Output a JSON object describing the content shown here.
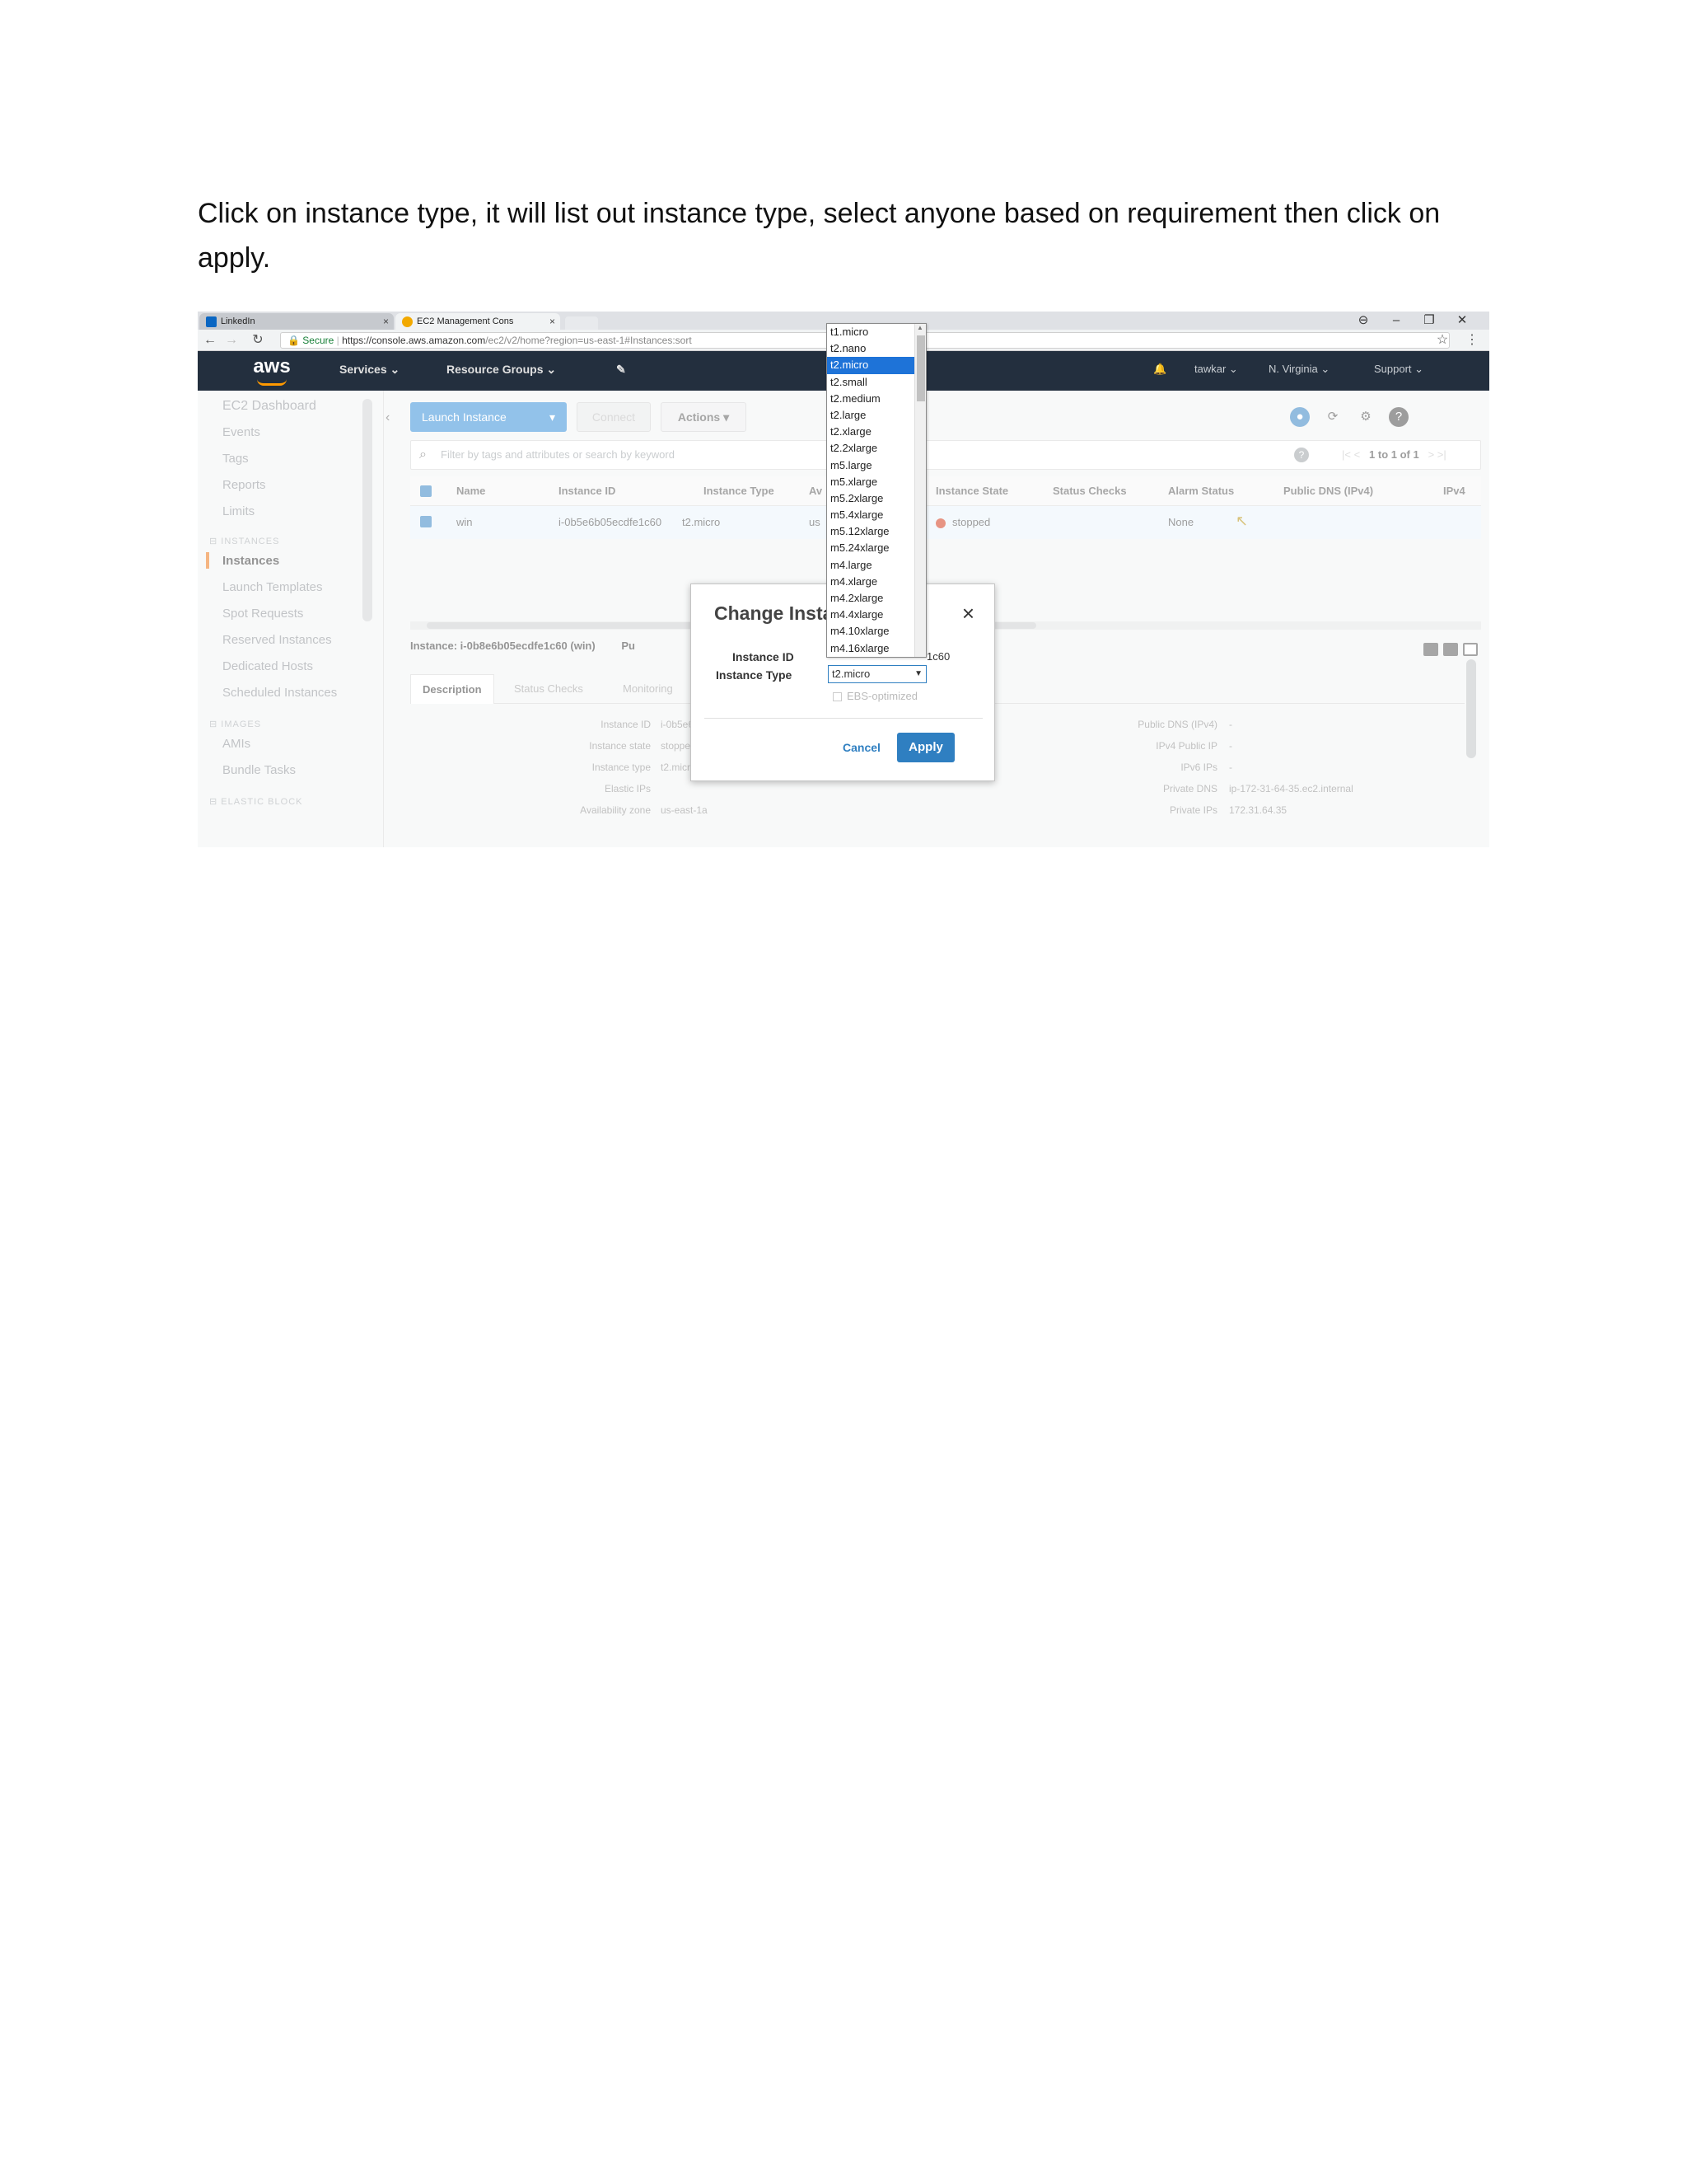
{
  "instruction": "Click on instance type, it will list out instance type, select anyone based on requirement then click on apply.",
  "browser": {
    "tabs": [
      {
        "label": "LinkedIn",
        "close": "×"
      },
      {
        "label": "EC2 Management Cons",
        "close": "×"
      }
    ],
    "secure_label": "Secure",
    "url": "https://console.aws.amazon.com/ec2/v2/home?region=us-east-1#Instances:sort",
    "url_host": "https://console.aws.amazon.com",
    "url_path": "/ec2/v2/home?region=us-east-1#Instances:sort",
    "window_controls": [
      "⊖",
      "–",
      "❐",
      "✕"
    ]
  },
  "aws_nav": {
    "logo": "aws",
    "services": "Services ⌄",
    "resource_groups": "Resource Groups ⌄",
    "pin": "✎",
    "bell": "🔔",
    "user": "tawkar ⌄",
    "region": "N. Virginia ⌄",
    "support": "Support ⌄"
  },
  "sidebar": {
    "items_top": [
      "EC2 Dashboard",
      "Events",
      "Tags",
      "Reports",
      "Limits"
    ],
    "section_instances": "INSTANCES",
    "instances_items": [
      "Instances",
      "Launch Templates",
      "Spot Requests",
      "Reserved Instances",
      "Dedicated Hosts",
      "Scheduled Instances"
    ],
    "section_images": "IMAGES",
    "images_items": [
      "AMIs",
      "Bundle Tasks"
    ],
    "section_ebs": "ELASTIC BLOCK"
  },
  "toolbar": {
    "launch_label": "Launch Instance",
    "launch_caret": "▾",
    "connect_label": "Connect",
    "actions_label": "Actions ▾"
  },
  "filter": {
    "placeholder": "Filter by tags and attributes or search by keyword",
    "pager": "1 to 1 of 1",
    "pager_prev": "|<  <",
    "pager_next": ">  >|"
  },
  "table": {
    "headers": [
      "Name",
      "Instance ID",
      "Instance Type",
      "Av",
      "Instance State",
      "Status Checks",
      "Alarm Status",
      "Public DNS (IPv4)",
      "IPv4"
    ],
    "row": {
      "name": "win",
      "instance_id": "i-0b5e6b05ecdfe1c60",
      "instance_type": "t2.micro",
      "az": "us",
      "state": "stopped",
      "alarm": "None"
    }
  },
  "details": {
    "header": "Instance: i-0b8e6b05ecdfe1c60 (win)",
    "header_suffix": "Pu",
    "tabs": [
      "Description",
      "Status Checks",
      "Monitoring"
    ],
    "left_keys": [
      "Instance ID",
      "Instance state",
      "Instance type",
      "Elastic IPs",
      "Availability zone"
    ],
    "left_values": [
      "i-0b5e6b05",
      "stopped",
      "t2.micro",
      "",
      "us-east-1a"
    ],
    "right_keys": [
      "Public DNS (IPv4)",
      "IPv4 Public IP",
      "IPv6 IPs",
      "Private DNS",
      "Private IPs"
    ],
    "right_values": [
      "-",
      "-",
      "-",
      "ip-172-31-64-35.ec2.internal",
      "172.31.64.35"
    ]
  },
  "modal": {
    "title": "Change Instance Type",
    "close": "×",
    "instance_id_label": "Instance ID",
    "instance_id_value": "1c60",
    "instance_type_label": "Instance Type",
    "selected_type": "t2.micro",
    "ebs_label": "EBS-optimized",
    "cancel_label": "Cancel",
    "apply_label": "Apply"
  },
  "dropdown": {
    "selected_index": 2,
    "options": [
      "t1.micro",
      "t2.nano",
      "t2.micro",
      "t2.small",
      "t2.medium",
      "t2.large",
      "t2.xlarge",
      "t2.2xlarge",
      "m5.large",
      "m5.xlarge",
      "m5.2xlarge",
      "m5.4xlarge",
      "m5.12xlarge",
      "m5.24xlarge",
      "m4.large",
      "m4.xlarge",
      "m4.2xlarge",
      "m4.4xlarge",
      "m4.10xlarge",
      "m4.16xlarge"
    ]
  },
  "colors": {
    "aws_nav_bg": "#232f3e",
    "aws_orange": "#ff9900",
    "primary_blue": "#2f7fc1",
    "selection_blue": "#1e73d8",
    "stopped_red": "#d13212"
  }
}
